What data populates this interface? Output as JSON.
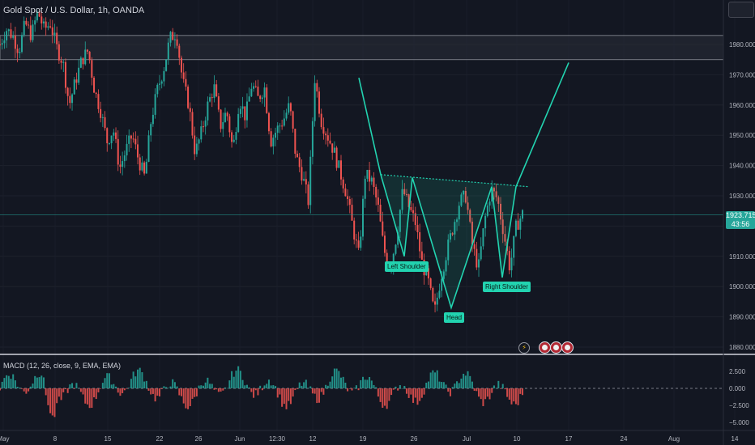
{
  "header": {
    "symbol_line": "Gold Spot / U.S. Dollar, 1h, OANDA"
  },
  "macd": {
    "label": "MACD (12, 26, close, 9, EMA, EMA)"
  },
  "current_price": {
    "value": "1923.715",
    "countdown": "43:56"
  },
  "pattern_labels": {
    "left_shoulder": "Left Shoulder",
    "head": "Head",
    "right_shoulder": "Right Shoulder"
  },
  "colors": {
    "background": "#131722",
    "up": "#26a69a",
    "down": "#ef5350",
    "pattern": "#22d3b0",
    "zone": "#2a2e39"
  },
  "chart_data": [
    {
      "type": "candlestick",
      "title": "Gold Spot / U.S. Dollar, 1h, OANDA",
      "y_ticks": [
        1880.0,
        1890.0,
        1900.0,
        1910.0,
        1920.0,
        1930.0,
        1940.0,
        1950.0,
        1960.0,
        1970.0,
        1980.0
      ],
      "y_tick_labels": [
        "1880.000",
        "1890.000",
        "1900.000",
        "1910.000",
        "1920.000",
        "1930.000",
        "1940.000",
        "1950.000",
        "1960.000",
        "1970.000",
        "1980.000"
      ],
      "x_tick_labels": [
        "May",
        "8",
        "15",
        "22",
        "26",
        "Jun",
        "12:30",
        "12",
        "19",
        "26",
        "Jul",
        "10",
        "17",
        "24",
        "Aug",
        "14"
      ],
      "ylim": [
        1877,
        1992
      ],
      "price_path": [
        [
          1980,
          1985
        ],
        [
          1983,
          1978
        ],
        [
          1987,
          1983
        ],
        [
          1991,
          1985
        ],
        [
          1987,
          1979
        ],
        [
          1974,
          1960
        ],
        [
          1968,
          1975
        ],
        [
          1978,
          1965
        ],
        [
          1958,
          1948
        ],
        [
          1952,
          1939
        ],
        [
          1945,
          1950
        ],
        [
          1942,
          1936
        ],
        [
          1955,
          1965
        ],
        [
          1972,
          1982
        ],
        [
          1984,
          1968
        ],
        [
          1960,
          1944
        ],
        [
          1951,
          1960
        ],
        [
          1966,
          1953
        ],
        [
          1958,
          1945
        ],
        [
          1962,
          1956
        ],
        [
          1967,
          1962
        ],
        [
          1966,
          1948
        ],
        [
          1952,
          1955
        ],
        [
          1960,
          1943
        ],
        [
          1937,
          1928
        ],
        [
          1969,
          1955
        ],
        [
          1950,
          1945
        ],
        [
          1938,
          1931
        ],
        [
          1920,
          1910
        ],
        [
          1937,
          1935
        ],
        [
          1927,
          1912
        ],
        [
          1906,
          1917
        ],
        [
          1932,
          1926
        ],
        [
          1921,
          1908
        ],
        [
          1902,
          1891
        ],
        [
          1903,
          1912
        ],
        [
          1920,
          1928
        ],
        [
          1930,
          1914
        ],
        [
          1906,
          1922
        ],
        [
          1932,
          1929
        ],
        [
          1918,
          1906
        ],
        [
          1920,
          1924
        ]
      ],
      "support_resistance_zone": [
        1975,
        1983
      ],
      "current_price": 1923.715,
      "pattern": {
        "name": "Head and Shoulders (inverse)",
        "points": [
          [
            "Jun 19",
            1969
          ],
          [
            "",
            1937
          ],
          [
            "Left Shoulder",
            1910
          ],
          [
            "",
            1936
          ],
          [
            "Head",
            1893
          ],
          [
            "",
            1933
          ],
          [
            "Right Shoulder",
            1903
          ],
          [
            "",
            1933
          ],
          [
            "target",
            1974
          ]
        ],
        "neckline": [
          1937,
          1933
        ]
      }
    },
    {
      "type": "histogram",
      "title": "MACD (12, 26, close, 9, EMA, EMA)",
      "y_ticks": [
        2.5,
        0.0,
        -2.5,
        -5.0
      ],
      "y_tick_labels": [
        "2.500",
        "0.000",
        "−2.500",
        "−5.000"
      ],
      "ylim": [
        -5.8,
        3.8
      ]
    }
  ]
}
